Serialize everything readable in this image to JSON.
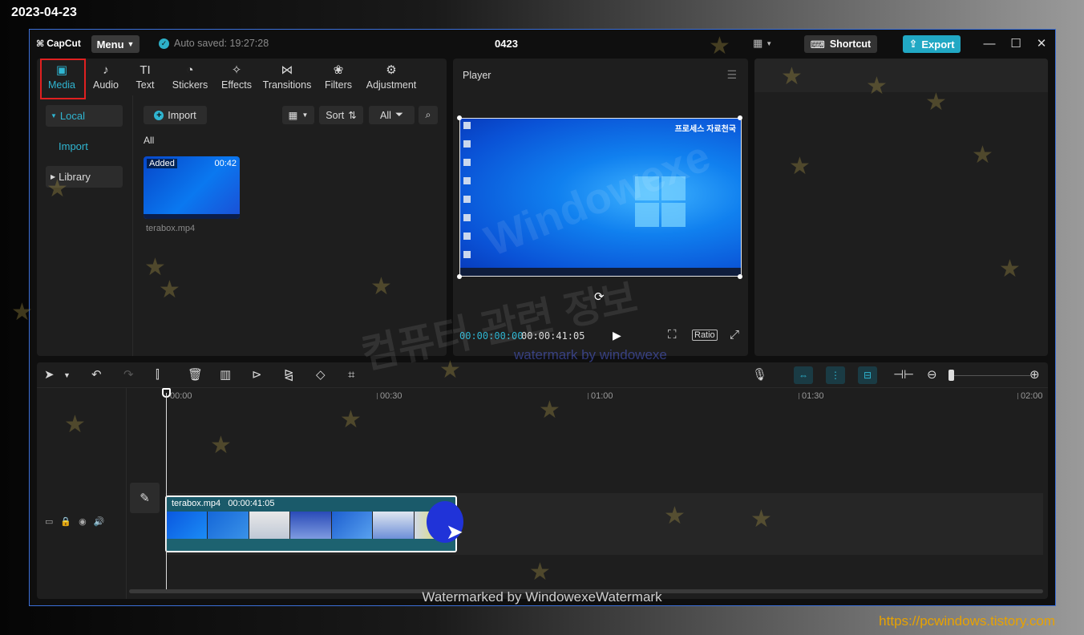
{
  "overlay": {
    "date": "2023-04-23",
    "url": "https://pcwindows.tistory.com",
    "watermark_bottom": "Watermarked by WindowexeWatermark",
    "watermark_diag": "Windowexe",
    "watermark_korean": "컴퓨터 관련 정보",
    "watermark_small": "watermark by windowexe"
  },
  "titlebar": {
    "logo": "CapCut",
    "menu": "Menu",
    "autosave": "Auto saved: 19:27:28",
    "project": "0423",
    "shortcut": "Shortcut",
    "export": "Export"
  },
  "media_tabs": [
    {
      "label": "Media",
      "icon": "media-icon",
      "active": true
    },
    {
      "label": "Audio",
      "icon": "audio-icon"
    },
    {
      "label": "Text",
      "icon": "text-icon"
    },
    {
      "label": "Stickers",
      "icon": "sticker-icon"
    },
    {
      "label": "Effects",
      "icon": "effects-icon"
    },
    {
      "label": "Transitions",
      "icon": "transitions-icon"
    },
    {
      "label": "Filters",
      "icon": "filters-icon"
    },
    {
      "label": "Adjustment",
      "icon": "adjustment-icon"
    }
  ],
  "media_side": {
    "local": "Local",
    "import": "Import",
    "library": "Library"
  },
  "media_toolbar": {
    "import": "Import",
    "sort": "Sort",
    "all": "All"
  },
  "media_content": {
    "filter": "All",
    "item": {
      "badge": "Added",
      "duration": "00:42",
      "name": "terabox.mp4"
    }
  },
  "player": {
    "title": "Player",
    "desktop_text": "프로세스 자료천국",
    "current_time": "00:00:00:00",
    "total_time": "00:00:41:05",
    "ratio": "Ratio"
  },
  "timeline": {
    "ruler": [
      "00:00",
      "00:30",
      "01:00",
      "01:30",
      "02:00"
    ],
    "clip": {
      "name": "terabox.mp4",
      "duration": "00:00:41:05"
    }
  },
  "colors": {
    "accent": "#2fb5d1",
    "export": "#21a8c4",
    "highlight": "#e02020",
    "url": "#e8a200"
  }
}
